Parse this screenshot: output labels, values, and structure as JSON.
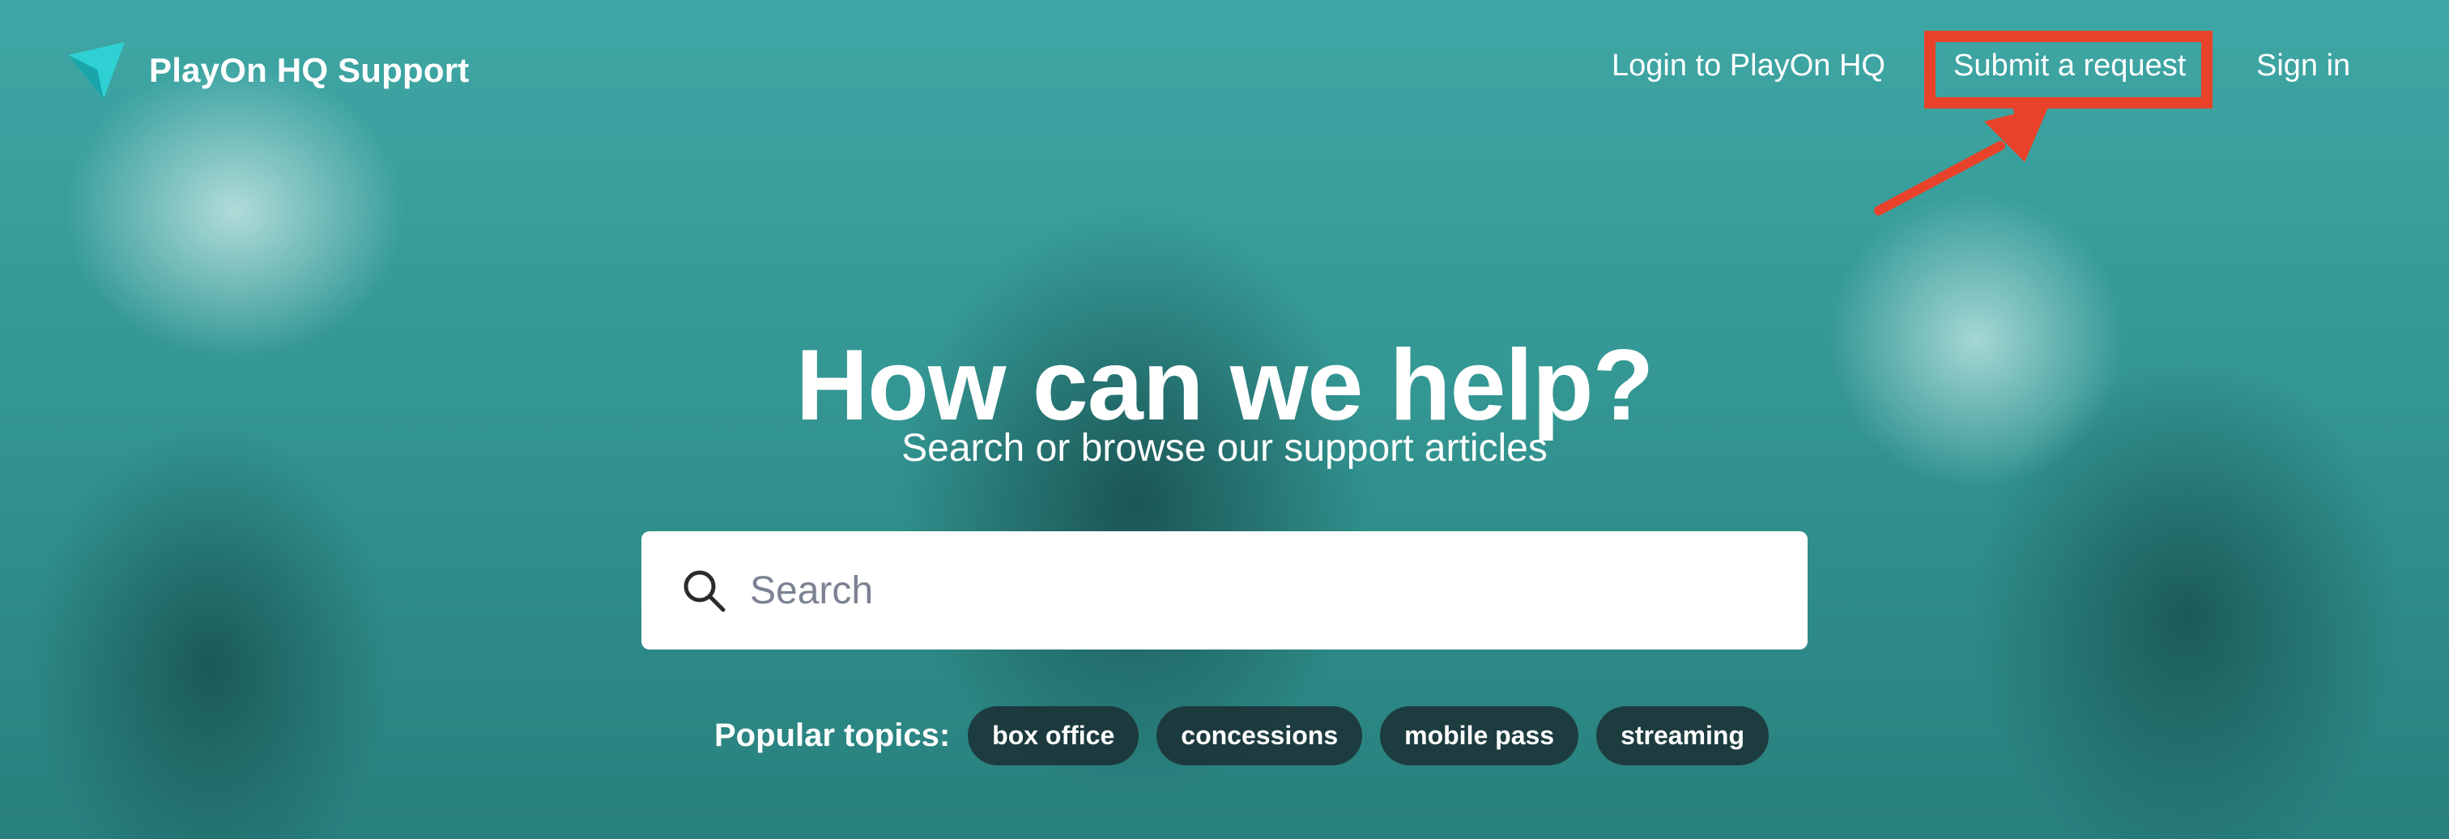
{
  "header": {
    "brand": "PlayOn HQ Support",
    "nav": {
      "login": "Login to PlayOn HQ",
      "submit_request": "Submit a request",
      "sign_in": "Sign in"
    }
  },
  "hero": {
    "title": "How can we help?",
    "subtitle": "Search or browse our support articles"
  },
  "search": {
    "placeholder": "Search",
    "value": ""
  },
  "popular": {
    "label": "Popular topics:",
    "topics": [
      "box office",
      "concessions",
      "mobile pass",
      "streaming"
    ]
  },
  "colors": {
    "highlight": "#e8432a",
    "hero_tint": "#3aa6a3",
    "chip_bg": "#1c2b2f"
  },
  "icons": {
    "logo": "paper-plane-icon",
    "search": "search-icon",
    "annotation": "arrow-icon"
  }
}
